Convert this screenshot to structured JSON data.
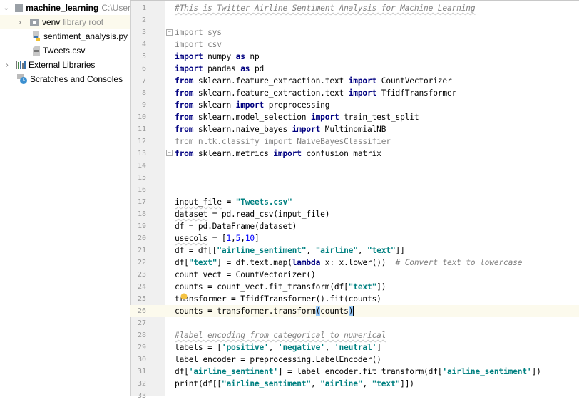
{
  "project_tree": {
    "root": {
      "name": "machine_learning",
      "path": "C:\\User"
    },
    "items": [
      {
        "name": "venv",
        "hint": "library root",
        "type": "folder"
      },
      {
        "name": "sentiment_analysis.py",
        "type": "python-file"
      },
      {
        "name": "Tweets.csv",
        "type": "text-file"
      }
    ],
    "external_libraries": "External Libraries",
    "scratches": "Scratches and Consoles"
  },
  "editor": {
    "file": "sentiment_analysis.py",
    "current_line": 26,
    "lines": [
      {
        "n": "1",
        "tokens": [
          {
            "t": "#This is Twitter Airline Sentiment Analysis for Machine Learning",
            "c": "com sq"
          }
        ]
      },
      {
        "n": "2",
        "tokens": []
      },
      {
        "n": "3",
        "tokens": [
          {
            "t": "import",
            "c": "dim"
          },
          {
            "t": " sys",
            "c": "dim"
          }
        ]
      },
      {
        "n": "4",
        "tokens": [
          {
            "t": "import",
            "c": "dim"
          },
          {
            "t": " csv",
            "c": "dim"
          }
        ]
      },
      {
        "n": "5",
        "tokens": [
          {
            "t": "import",
            "c": "kw"
          },
          {
            "t": " numpy "
          },
          {
            "t": "as",
            "c": "kw"
          },
          {
            "t": " np"
          }
        ]
      },
      {
        "n": "6",
        "tokens": [
          {
            "t": "import",
            "c": "kw"
          },
          {
            "t": " pandas "
          },
          {
            "t": "as",
            "c": "kw"
          },
          {
            "t": " pd"
          }
        ]
      },
      {
        "n": "7",
        "tokens": [
          {
            "t": "from",
            "c": "kw"
          },
          {
            "t": " sklearn.feature_extraction.text "
          },
          {
            "t": "import",
            "c": "kw"
          },
          {
            "t": " CountVectorizer"
          }
        ]
      },
      {
        "n": "8",
        "tokens": [
          {
            "t": "from",
            "c": "kw"
          },
          {
            "t": " sklearn.feature_extraction.text "
          },
          {
            "t": "import",
            "c": "kw"
          },
          {
            "t": " TfidfTransformer"
          }
        ]
      },
      {
        "n": "9",
        "tokens": [
          {
            "t": "from",
            "c": "kw"
          },
          {
            "t": " sklearn "
          },
          {
            "t": "import",
            "c": "kw"
          },
          {
            "t": " preprocessing"
          }
        ]
      },
      {
        "n": "10",
        "tokens": [
          {
            "t": "from",
            "c": "kw"
          },
          {
            "t": " sklearn.model_selection "
          },
          {
            "t": "import",
            "c": "kw"
          },
          {
            "t": " train_test_split"
          }
        ]
      },
      {
        "n": "11",
        "tokens": [
          {
            "t": "from",
            "c": "kw"
          },
          {
            "t": " sklearn.naive_bayes "
          },
          {
            "t": "import",
            "c": "kw"
          },
          {
            "t": " MultinomialNB"
          }
        ]
      },
      {
        "n": "12",
        "tokens": [
          {
            "t": "from nltk.classify import NaiveBayesClassifier",
            "c": "dim"
          }
        ]
      },
      {
        "n": "13",
        "tokens": [
          {
            "t": "from",
            "c": "kw"
          },
          {
            "t": " sklearn.metrics "
          },
          {
            "t": "import",
            "c": "kw"
          },
          {
            "t": " confusion_matrix"
          }
        ]
      },
      {
        "n": "14",
        "tokens": []
      },
      {
        "n": "15",
        "tokens": []
      },
      {
        "n": "16",
        "tokens": []
      },
      {
        "n": "17",
        "tokens": [
          {
            "t": "input_file",
            "c": "sq"
          },
          {
            "t": " = "
          },
          {
            "t": "\"Tweets.csv\"",
            "c": "str"
          }
        ]
      },
      {
        "n": "18",
        "tokens": [
          {
            "t": "dataset",
            "c": "sq"
          },
          {
            "t": " = pd.read_csv(input_file)"
          }
        ]
      },
      {
        "n": "19",
        "tokens": [
          {
            "t": "df = pd.DataFrame(dataset)"
          }
        ]
      },
      {
        "n": "20",
        "tokens": [
          {
            "t": "usecols",
            "c": "sq"
          },
          {
            "t": " = ["
          },
          {
            "t": "1",
            "c": "num"
          },
          {
            "t": ","
          },
          {
            "t": "5",
            "c": "num"
          },
          {
            "t": ","
          },
          {
            "t": "10",
            "c": "num"
          },
          {
            "t": "]"
          }
        ]
      },
      {
        "n": "21",
        "tokens": [
          {
            "t": "df = df[["
          },
          {
            "t": "\"airline_sentiment\"",
            "c": "str"
          },
          {
            "t": ", "
          },
          {
            "t": "\"airline\"",
            "c": "str"
          },
          {
            "t": ", "
          },
          {
            "t": "\"text\"",
            "c": "str"
          },
          {
            "t": "]]"
          }
        ]
      },
      {
        "n": "22",
        "tokens": [
          {
            "t": "df["
          },
          {
            "t": "\"text\"",
            "c": "str"
          },
          {
            "t": "] = df.text.map("
          },
          {
            "t": "lambda",
            "c": "kw"
          },
          {
            "t": " x: x.lower())  "
          },
          {
            "t": "# Convert text to lowercase",
            "c": "com"
          }
        ]
      },
      {
        "n": "23",
        "tokens": [
          {
            "t": "count_vect = CountVectorizer()"
          }
        ]
      },
      {
        "n": "24",
        "tokens": [
          {
            "t": "counts = count_vect.fit_transform(df["
          },
          {
            "t": "\"text\"",
            "c": "str"
          },
          {
            "t": "])"
          }
        ]
      },
      {
        "n": "25",
        "tokens": [
          {
            "t": "transformer = TfidfTransformer().fit(counts)"
          }
        ]
      },
      {
        "n": "26",
        "tokens": [
          {
            "t": "counts = transformer.transform"
          },
          {
            "t": "(",
            "c": "brace"
          },
          {
            "t": "counts"
          },
          {
            "t": ")",
            "c": "brace"
          }
        ]
      },
      {
        "n": "27",
        "tokens": []
      },
      {
        "n": "28",
        "tokens": [
          {
            "t": "#label encoding from categorical to numerical",
            "c": "com sq"
          }
        ]
      },
      {
        "n": "29",
        "tokens": [
          {
            "t": "labels = ["
          },
          {
            "t": "'positive'",
            "c": "str"
          },
          {
            "t": ", "
          },
          {
            "t": "'negative'",
            "c": "str"
          },
          {
            "t": ", "
          },
          {
            "t": "'neutral'",
            "c": "str"
          },
          {
            "t": "]"
          }
        ]
      },
      {
        "n": "30",
        "tokens": [
          {
            "t": "label_encoder = preprocessing.LabelEncoder()"
          }
        ]
      },
      {
        "n": "31",
        "tokens": [
          {
            "t": "df["
          },
          {
            "t": "'airline_sentiment'",
            "c": "str"
          },
          {
            "t": "] = label_encoder.fit_transform(df["
          },
          {
            "t": "'airline_sentiment'",
            "c": "str"
          },
          {
            "t": "])"
          }
        ]
      },
      {
        "n": "32",
        "tokens": [
          {
            "t": "print",
            "c": ""
          },
          {
            "t": "(df[["
          },
          {
            "t": "\"airline_sentiment\"",
            "c": "str"
          },
          {
            "t": ", "
          },
          {
            "t": "\"airline\"",
            "c": "str"
          },
          {
            "t": ", "
          },
          {
            "t": "\"text\"",
            "c": "str"
          },
          {
            "t": "]])"
          }
        ]
      },
      {
        "n": "33",
        "tokens": []
      }
    ]
  }
}
